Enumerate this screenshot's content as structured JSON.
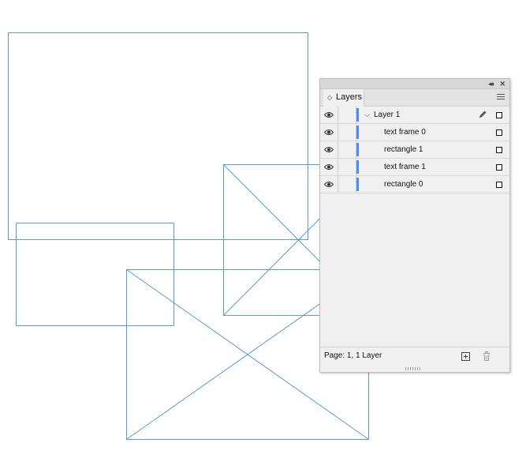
{
  "canvas": {
    "frame_color": "#5b9bd5"
  },
  "panel": {
    "collapse_glyph": "◂◂",
    "close_glyph": "✕",
    "tab": {
      "arrows": "◇",
      "label": "Layers"
    },
    "rows": [
      {
        "label": "Layer 1",
        "kind": "layer",
        "expanded": true,
        "visible": true,
        "edit_icon": "pencil-icon",
        "color": "#4a8ef5"
      },
      {
        "label": "text frame 0",
        "kind": "object",
        "visible": true,
        "color": "#4a8ef5"
      },
      {
        "label": "rectangle 1",
        "kind": "object",
        "visible": true,
        "color": "#4a8ef5"
      },
      {
        "label": "text frame 1",
        "kind": "object",
        "visible": true,
        "color": "#4a8ef5"
      },
      {
        "label": "rectangle 0",
        "kind": "object",
        "visible": true,
        "color": "#4a8ef5"
      }
    ],
    "footer": {
      "status": "Page: 1, 1 Layer",
      "new_layer_icon": "new-layer-icon",
      "delete_icon": "trash-icon"
    }
  }
}
